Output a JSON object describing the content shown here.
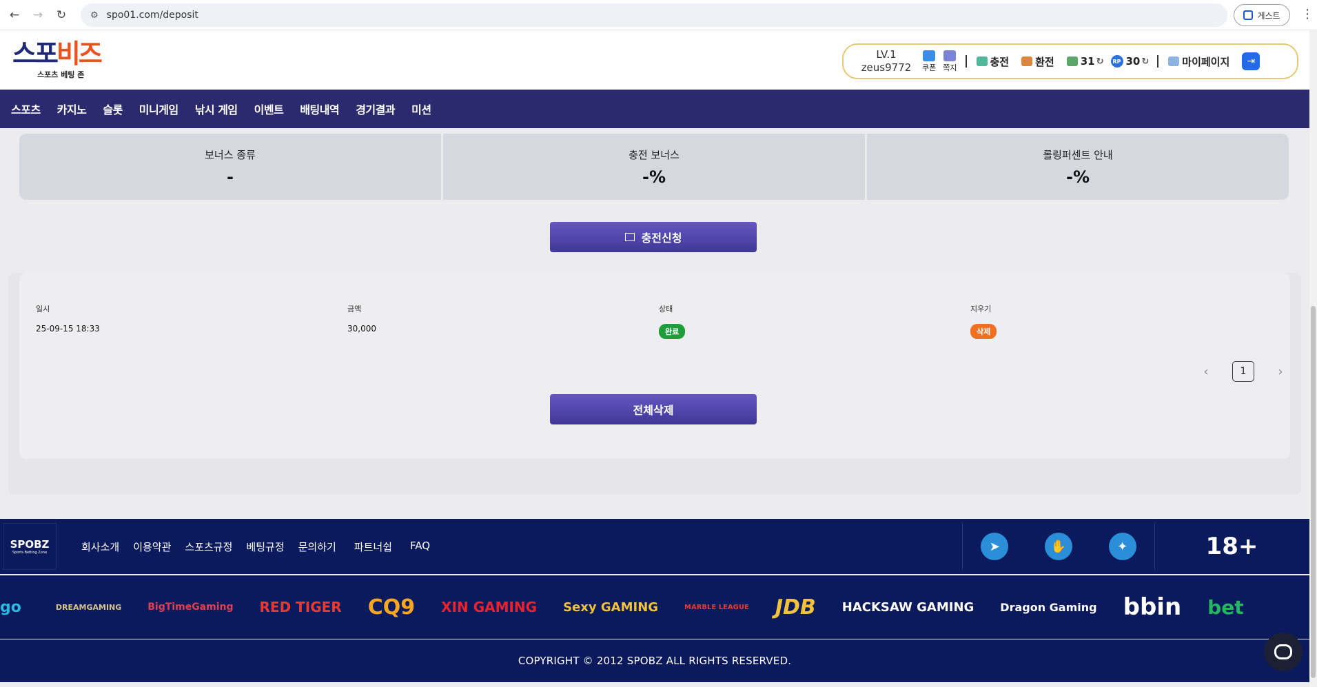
{
  "browser": {
    "url": "spo01.com/deposit",
    "guest_label": "게스트"
  },
  "header": {
    "logo_part1": "스포",
    "logo_part2": "비즈",
    "logo_sub": "스포츠 베팅 존",
    "level": "LV.1",
    "username": "zeus9772",
    "coupon_label": "쿠폰",
    "message_label": "쪽지",
    "charge_label": "충전",
    "exchange_label": "환전",
    "cash": "31",
    "points": "30",
    "rp_label": "RP",
    "mypage_label": "마이페이지"
  },
  "nav": [
    "스포츠",
    "카지노",
    "슬롯",
    "미니게임",
    "낚시 게임",
    "이벤트",
    "배팅내역",
    "경기결과",
    "미션"
  ],
  "bonus": [
    {
      "label": "보너스 종류",
      "value": "-"
    },
    {
      "label": "충전 보너스",
      "value": "-%"
    },
    {
      "label": "롤링퍼센트 안내",
      "value": "-%"
    }
  ],
  "deposit_button": "충전신청",
  "history": {
    "headers": [
      "일시",
      "금액",
      "상태",
      "지우기"
    ],
    "row": {
      "date": "25-09-15 18:33",
      "amount": "30,000",
      "status": "완료",
      "delete": "삭제"
    },
    "page": "1",
    "delete_all": "전체삭제"
  },
  "footer": {
    "logo": "SPOBZ",
    "logo_sub": "Sports Betting Zone",
    "links": [
      "회사소개",
      "이용약관",
      "스포츠규정",
      "베팅규정",
      "문의하기",
      "파트너쉽",
      "FAQ"
    ],
    "age": "18+",
    "providers": [
      "go",
      "DREAMGAMING",
      "BigTimeGaming",
      "RED TIGER",
      "CQ9",
      "XIN GAMING",
      "Sexy GAMING",
      "MARBLE LEAGUE",
      "JDB",
      "HACKSAW GAMING",
      "Dragon Gaming",
      "bbin",
      "bet"
    ],
    "copyright": "COPYRIGHT © 2012 SPOBZ ALL RIGHTS RESERVED."
  }
}
